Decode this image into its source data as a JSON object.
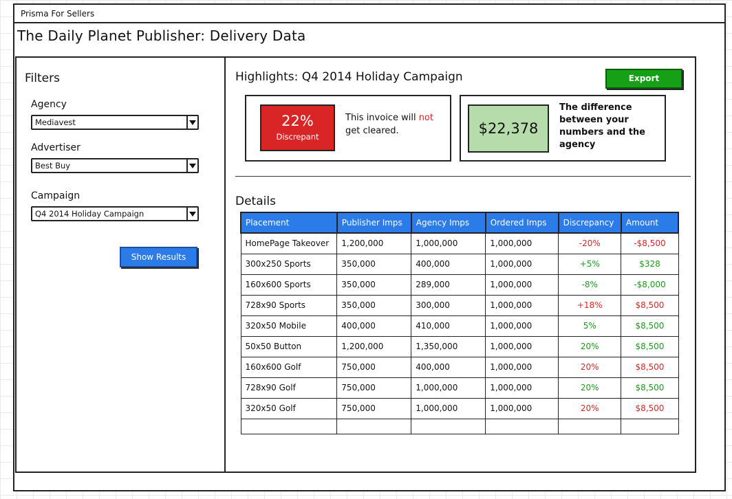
{
  "window": {
    "title": "Prisma For Sellers"
  },
  "page": {
    "title": "The Daily Planet Publisher: Delivery Data"
  },
  "filters": {
    "title": "Filters",
    "agency": {
      "label": "Agency",
      "value": "Mediavest"
    },
    "advertiser": {
      "label": "Advertiser",
      "value": "Best Buy"
    },
    "campaign": {
      "label": "Campaign",
      "value": "Q4 2014 Holiday Campaign"
    },
    "show_results_label": "Show Results"
  },
  "highlights": {
    "title": "Highlights: Q4 2014 Holiday Campaign",
    "export_label": "Export",
    "discrepancy_percent": "22%",
    "discrepancy_label": "Discrepant",
    "invoice_text_before": "This invoice will ",
    "invoice_text_not": "not",
    "invoice_text_after": " get cleared.",
    "difference_amount": "$22,378",
    "difference_text": "The difference between your numbers and the agency"
  },
  "colors": {
    "accent_blue": "#2b7ce8",
    "export_green": "#16a016",
    "discrepant_red": "#d92525",
    "difference_green": "#b6dcab",
    "positive_text": "#1a9a1a",
    "negative_text": "#d92525"
  },
  "details": {
    "title": "Details",
    "columns": [
      "Placement",
      "Publisher Imps",
      "Agency Imps",
      "Ordered Imps",
      "Discrepancy",
      "Amount"
    ],
    "rows": [
      {
        "placement": "HomePage Takeover",
        "publisher": "1,200,000",
        "agency": "1,000,000",
        "ordered": "1,000,000",
        "discrepancy": "-20%",
        "amount": "-$8,500",
        "disc_status": "negative",
        "amt_status": "negative"
      },
      {
        "placement": "300x250 Sports",
        "publisher": "350,000",
        "agency": "400,000",
        "ordered": "1,000,000",
        "discrepancy": "+5%",
        "amount": "$328",
        "disc_status": "positive",
        "amt_status": "positive"
      },
      {
        "placement": "160x600 Sports",
        "publisher": "350,000",
        "agency": "289,000",
        "ordered": "1,000,000",
        "discrepancy": "-8%",
        "amount": "-$8,000",
        "disc_status": "positive",
        "amt_status": "positive"
      },
      {
        "placement": "728x90 Sports",
        "publisher": "350,000",
        "agency": "300,000",
        "ordered": "1,000,000",
        "discrepancy": "+18%",
        "amount": "$8,500",
        "disc_status": "negative",
        "amt_status": "negative"
      },
      {
        "placement": "320x50 Mobile",
        "publisher": "400,000",
        "agency": "410,000",
        "ordered": "1,000,000",
        "discrepancy": "5%",
        "amount": "$8,500",
        "disc_status": "positive",
        "amt_status": "positive"
      },
      {
        "placement": "50x50 Button",
        "publisher": "1,200,000",
        "agency": "1,350,000",
        "ordered": "1,000,000",
        "discrepancy": "20%",
        "amount": "$8,500",
        "disc_status": "positive",
        "amt_status": "positive"
      },
      {
        "placement": "160x600 Golf",
        "publisher": "750,000",
        "agency": "400,000",
        "ordered": "1,000,000",
        "discrepancy": "20%",
        "amount": "$8,500",
        "disc_status": "negative",
        "amt_status": "negative"
      },
      {
        "placement": "728x90 Golf",
        "publisher": "750,000",
        "agency": "1,000,000",
        "ordered": "1,000,000",
        "discrepancy": "20%",
        "amount": "$8,500",
        "disc_status": "positive",
        "amt_status": "positive"
      },
      {
        "placement": "320x50 Golf",
        "publisher": "750,000",
        "agency": "1,000,000",
        "ordered": "1,000,000",
        "discrepancy": "20%",
        "amount": "$8,500",
        "disc_status": "negative",
        "amt_status": "negative"
      }
    ]
  }
}
